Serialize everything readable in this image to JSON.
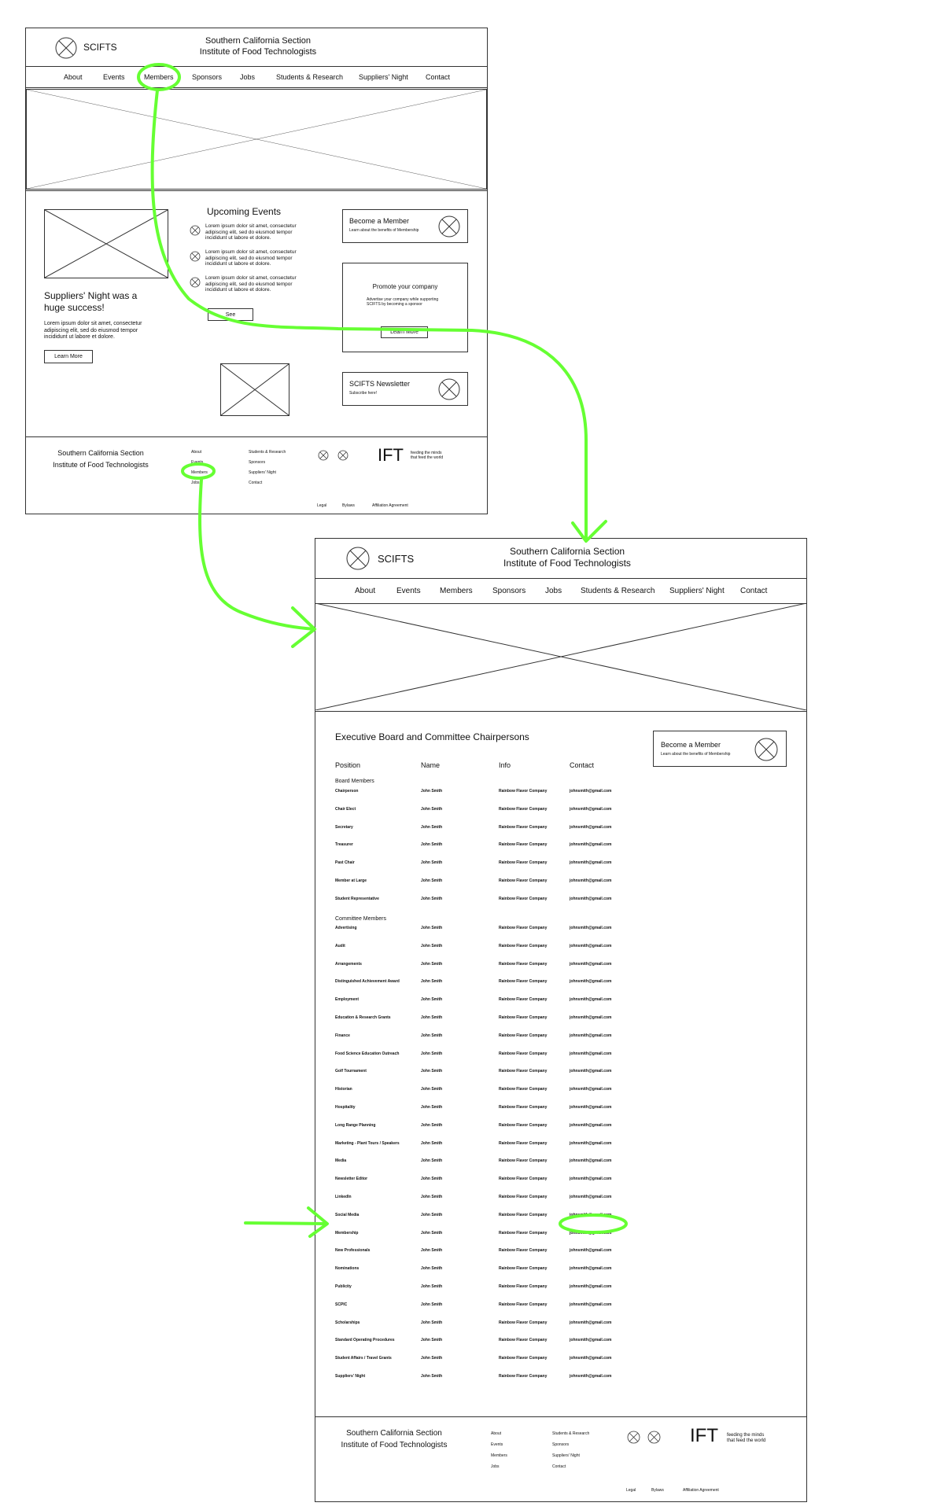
{
  "site": {
    "logo_text": "SCIFTS",
    "org_line1": "Southern California Section",
    "org_line2": "Institute of Food Technologists"
  },
  "nav": [
    "About",
    "Events",
    "Members",
    "Sponsors",
    "Jobs",
    "Students & Research",
    "Suppliers' Night",
    "Contact"
  ],
  "home": {
    "feature_title_1": "Suppliers' Night was a",
    "feature_title_2": "huge success!",
    "feature_body": "Lorem ipsum dolor sit amet, consectetur adipiscing elit, sed do eiusmod tempor incididunt ut labore et dolore.",
    "feature_button": "Learn More",
    "events_title": "Upcoming Events",
    "events": [
      "Lorem ipsum dolor sit amet, consectetur adipiscing elit, sed do eiusmod tempor incididunt ut labore et dolore.",
      "Lorem ipsum dolor sit amet, consectetur adipiscing elit, sed do eiusmod tempor incididunt ut labore et dolore.",
      "Lorem ipsum dolor sit amet, consectetur adipiscing elit, sed do eiusmod tempor incididunt ut labore et dolore."
    ],
    "see_button": "See",
    "member_card_title": "Become a Member",
    "member_card_sub": "Learn about the benefits of Membership",
    "promote_title": "Promote your company",
    "promote_sub": "Advertise your company while supporting SCIFTS by becoming a sponsor",
    "promote_button": "Learn More",
    "newsletter_title": "SCIFTS Newsletter",
    "newsletter_sub": "Subscribe here!"
  },
  "footer": {
    "col1": [
      "About",
      "Events",
      "Members",
      "Jobs"
    ],
    "col2": [
      "Students & Research",
      "Sponsors",
      "Suppliers' Night",
      "Contact"
    ],
    "ift_logo": "IFT",
    "tagline_1": "feeding the minds",
    "tagline_2": "that feed the world",
    "legal": [
      "Legal",
      "Bylaws",
      "Affiliation Agreement"
    ]
  },
  "members_page": {
    "title": "Executive Board and Committee Chairpersons",
    "headers": [
      "Position",
      "Name",
      "Info",
      "Contact"
    ],
    "board_heading": "Board Members",
    "committee_heading": "Committee Members",
    "board": [
      [
        "Chairperson",
        "John Smith",
        "Rainbow Flavor Company",
        "johnsmith@gmail.com"
      ],
      [
        "Chair Elect",
        "John Smith",
        "Rainbow Flavor Company",
        "johnsmith@gmail.com"
      ],
      [
        "Secretary",
        "John Smith",
        "Rainbow Flavor Company",
        "johnsmith@gmail.com"
      ],
      [
        "Treasurer",
        "John Smith",
        "Rainbow Flavor Company",
        "johnsmith@gmail.com"
      ],
      [
        "Past Chair",
        "John Smith",
        "Rainbow Flavor Company",
        "johnsmith@gmail.com"
      ],
      [
        "Member at Large",
        "John Smith",
        "Rainbow Flavor Company",
        "johnsmith@gmail.com"
      ],
      [
        "Student Representative",
        "John Smith",
        "Rainbow Flavor Company",
        "johnsmith@gmail.com"
      ]
    ],
    "committee": [
      [
        "Advertising",
        "John Smith",
        "Rainbow Flavor Company",
        "johnsmith@gmail.com"
      ],
      [
        "Audit",
        "John Smith",
        "Rainbow Flavor Company",
        "johnsmith@gmail.com"
      ],
      [
        "Arrangements",
        "John Smith",
        "Rainbow Flavor Company",
        "johnsmith@gmail.com"
      ],
      [
        "Distinguished Achievement Award",
        "John Smith",
        "Rainbow Flavor Company",
        "johnsmith@gmail.com"
      ],
      [
        "Employment",
        "John Smith",
        "Rainbow Flavor Company",
        "johnsmith@gmail.com"
      ],
      [
        "Education & Research Grants",
        "John Smith",
        "Rainbow Flavor Company",
        "johnsmith@gmail.com"
      ],
      [
        "Finance",
        "John Smith",
        "Rainbow Flavor Company",
        "johnsmith@gmail.com"
      ],
      [
        "Food Science Education Outreach",
        "John Smith",
        "Rainbow Flavor Company",
        "johnsmith@gmail.com"
      ],
      [
        "Golf Tournament",
        "John Smith",
        "Rainbow Flavor Company",
        "johnsmith@gmail.com"
      ],
      [
        "Historian",
        "John Smith",
        "Rainbow Flavor Company",
        "johnsmith@gmail.com"
      ],
      [
        "Hospitality",
        "John Smith",
        "Rainbow Flavor Company",
        "johnsmith@gmail.com"
      ],
      [
        "Long Range Planning",
        "John Smith",
        "Rainbow Flavor Company",
        "johnsmith@gmail.com"
      ],
      [
        "Marketing - Plant Tours / Speakers",
        "John Smith",
        "Rainbow Flavor Company",
        "johnsmith@gmail.com"
      ],
      [
        "Media",
        "John Smith",
        "Rainbow Flavor Company",
        "johnsmith@gmail.com"
      ],
      [
        "Newsletter Editor",
        "John Smith",
        "Rainbow Flavor Company",
        "johnsmith@gmail.com"
      ],
      [
        "LinkedIn",
        "John Smith",
        "Rainbow Flavor Company",
        "johnsmith@gmail.com"
      ],
      [
        "Social Media",
        "John Smith",
        "Rainbow Flavor Company",
        "johnsmith@gmail.com"
      ],
      [
        "Membership",
        "John Smith",
        "Rainbow Flavor Company",
        "johnsmith@gmail.com"
      ],
      [
        "New Professionals",
        "John Smith",
        "Rainbow Flavor Company",
        "johnsmith@gmail.com"
      ],
      [
        "Nominations",
        "John Smith",
        "Rainbow Flavor Company",
        "johnsmith@gmail.com"
      ],
      [
        "Publicity",
        "John Smith",
        "Rainbow Flavor Company",
        "johnsmith@gmail.com"
      ],
      [
        "SCPIC",
        "John Smith",
        "Rainbow Flavor Company",
        "johnsmith@gmail.com"
      ],
      [
        "Scholarships",
        "John Smith",
        "Rainbow Flavor Company",
        "johnsmith@gmail.com"
      ],
      [
        "Standard Operating Procedures",
        "John Smith",
        "Rainbow Flavor Company",
        "johnsmith@gmail.com"
      ],
      [
        "Student Affairs / Travel Grants",
        "John Smith",
        "Rainbow Flavor Company",
        "johnsmith@gmail.com"
      ],
      [
        "Suppliers' Night",
        "John Smith",
        "Rainbow Flavor Company",
        "johnsmith@gmail.com"
      ]
    ]
  },
  "colors": {
    "annotation": "#66ff33",
    "wire": "#333333"
  }
}
